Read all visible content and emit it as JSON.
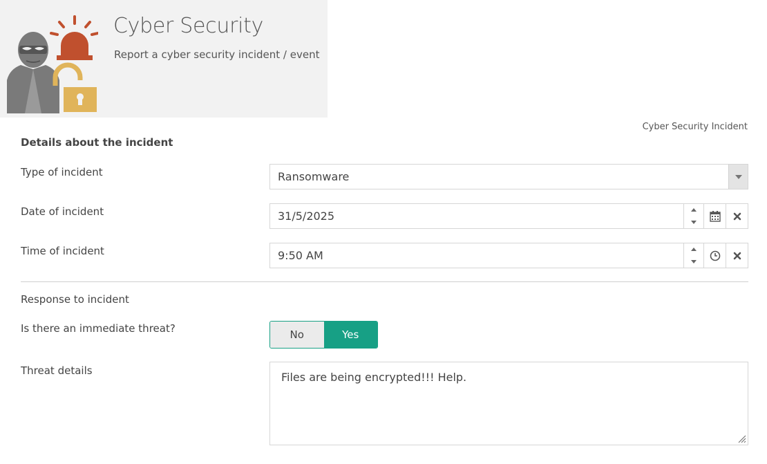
{
  "header": {
    "title": "Cyber Security",
    "subtitle": "Report a cyber security incident / event"
  },
  "form_name": "Cyber Security Incident",
  "section_details": "Details about the incident",
  "type_of_incident": {
    "label": "Type of incident",
    "value": "Ransomware"
  },
  "date_of_incident": {
    "label": "Date of incident",
    "value": "31/5/2025"
  },
  "time_of_incident": {
    "label": "Time of incident",
    "value": "9:50 AM"
  },
  "section_response": "Response to incident",
  "immediate_threat": {
    "label": "Is there an immediate threat?",
    "options": [
      "No",
      "Yes"
    ],
    "selected": "Yes"
  },
  "threat_details": {
    "label": "Threat details",
    "value": "Files are being encrypted!!! Help."
  },
  "colors": {
    "accent": "#17a085",
    "header_bg": "#f2f2f2",
    "alarm": "#c0502e",
    "lock": "#e0b45a",
    "figure": "#7a7a7a"
  },
  "icons": [
    "hacker-icon",
    "alarm-icon",
    "padlock-icon",
    "calendar-icon",
    "clock-icon",
    "clear-icon",
    "dropdown-caret-icon"
  ]
}
